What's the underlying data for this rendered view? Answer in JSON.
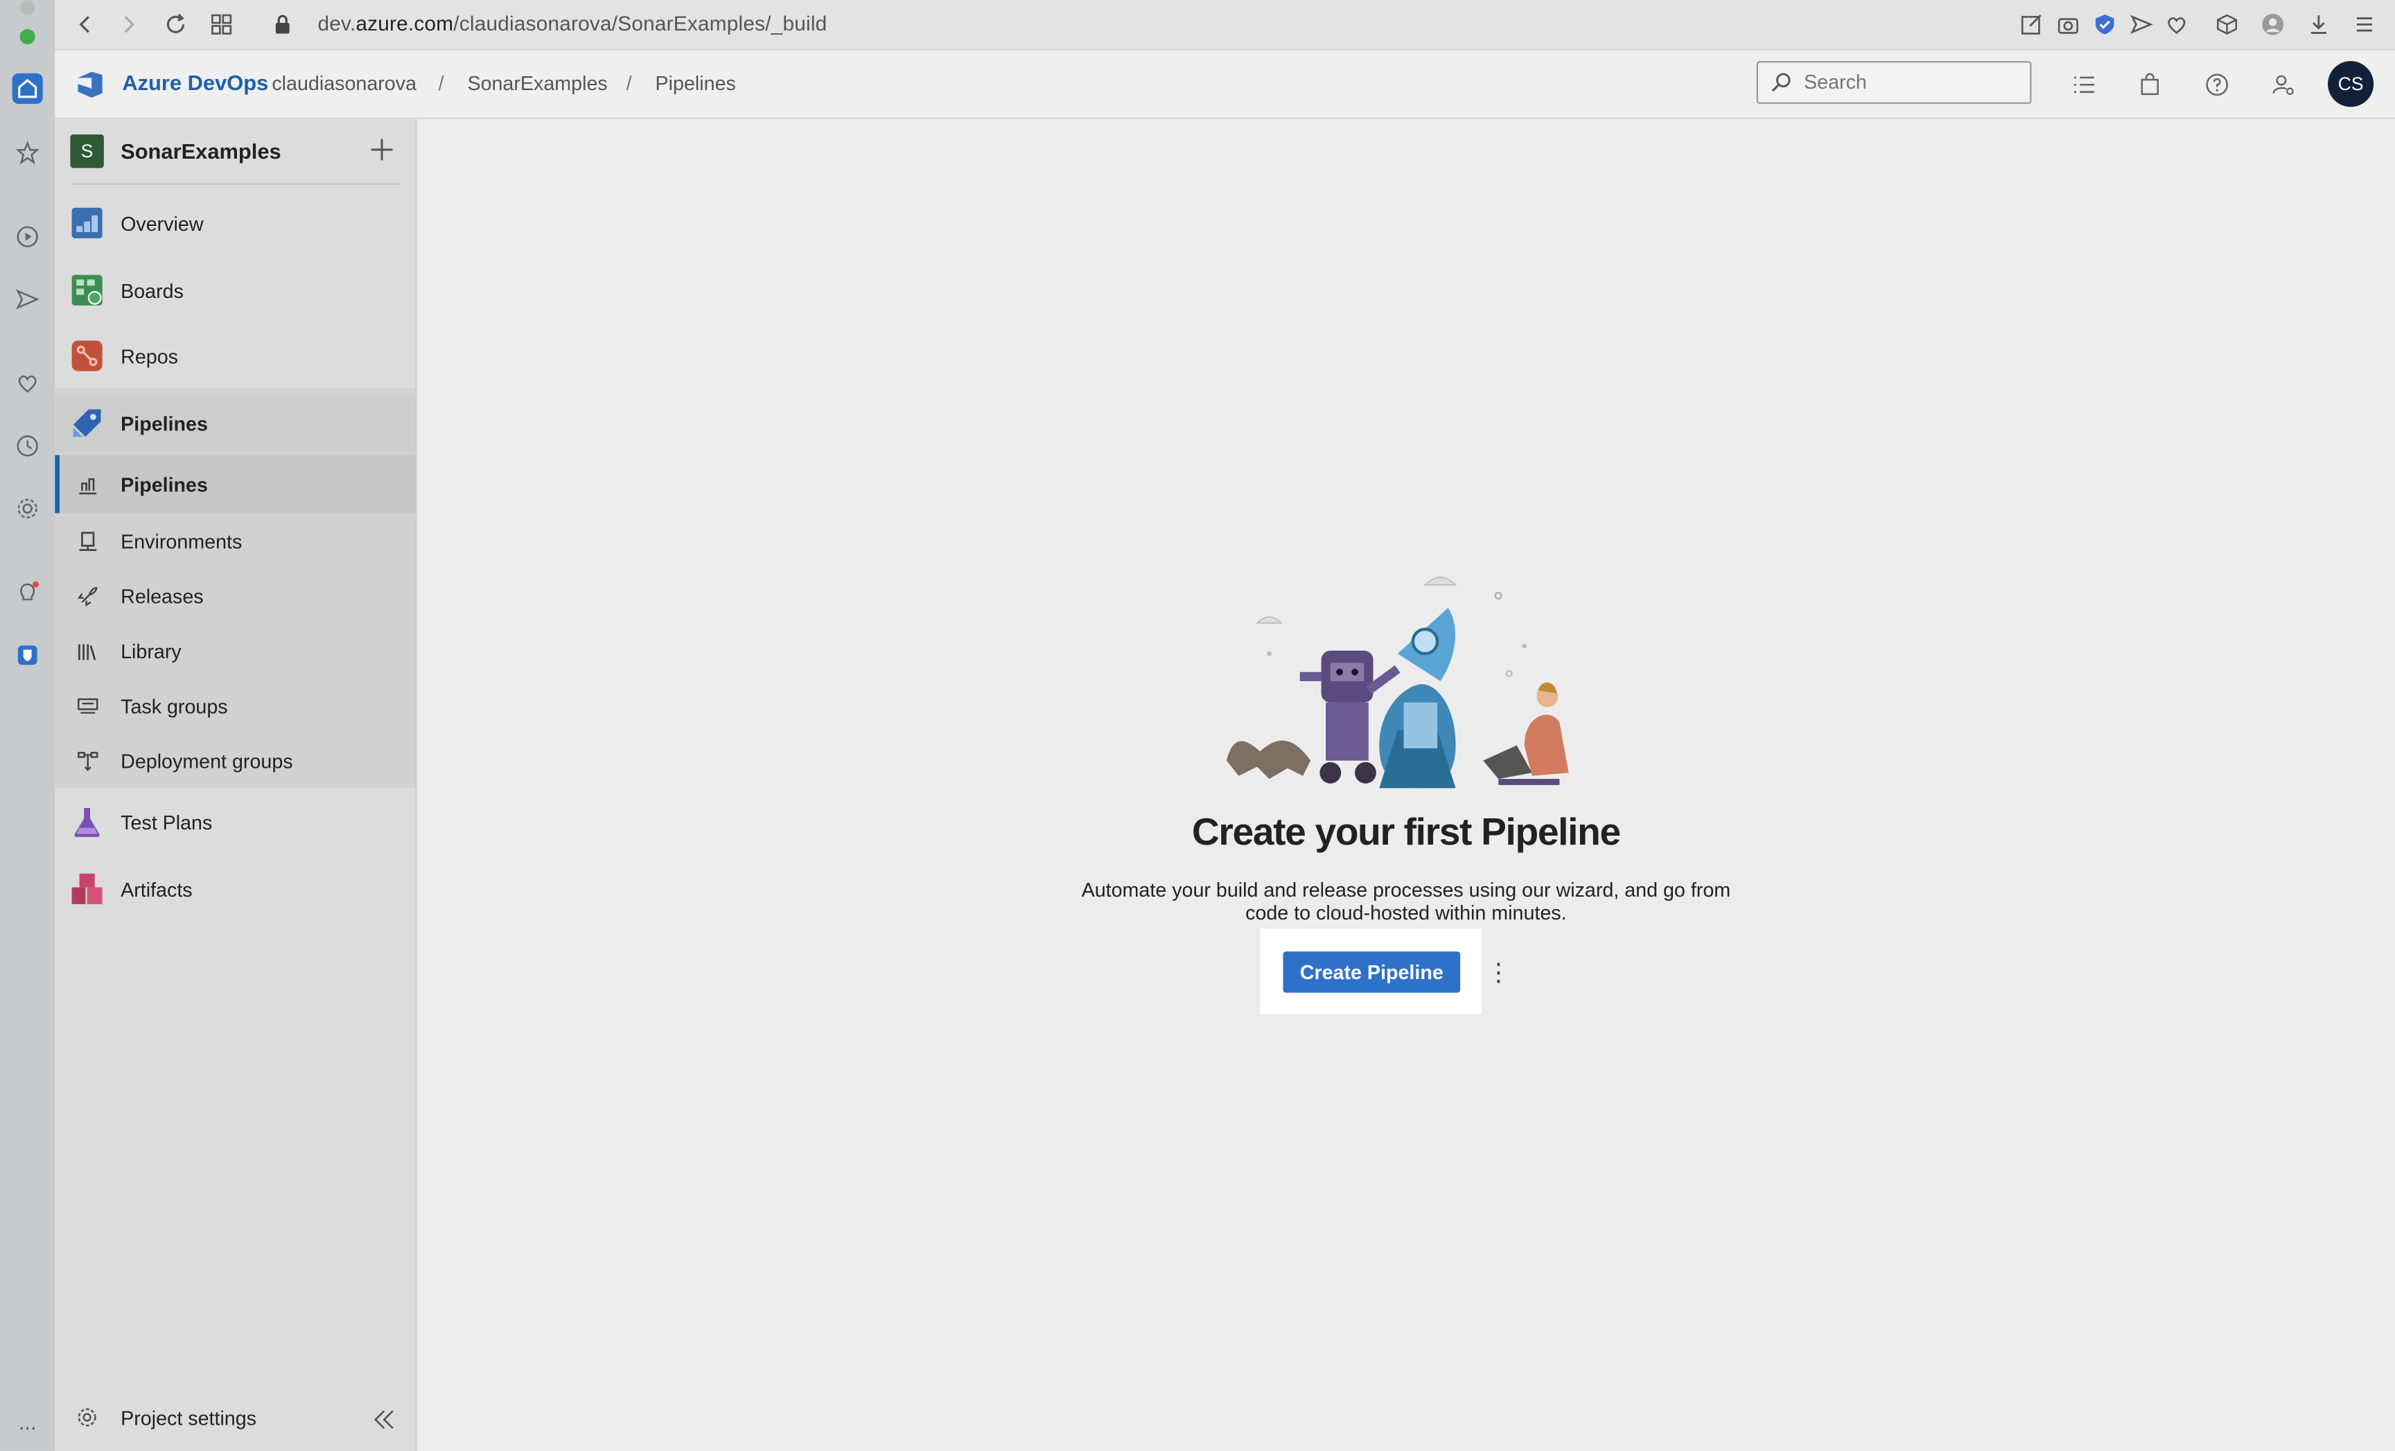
{
  "browser": {
    "url_prefix": "dev.",
    "url_domain": "azure.com",
    "url_path": "/claudiasonarova/SonarExamples/_build",
    "rail_icons": [
      "home-icon",
      "star-icon",
      "play-icon",
      "send-icon",
      "heart-icon",
      "clock-icon",
      "gear-icon",
      "lightbulb-icon",
      "vpn-shield-icon"
    ],
    "rail_more": "...",
    "toolbar_icons": [
      "back-arrow-icon",
      "forward-arrow-icon",
      "reload-icon",
      "tabs-grid-icon",
      "lock-icon",
      "edit-icon",
      "camera-icon",
      "shield-check-icon",
      "send-icon",
      "heart-icon",
      "cube-icon",
      "profile-icon",
      "download-icon",
      "menu-icon"
    ]
  },
  "header": {
    "brand": "Azure DevOps",
    "breadcrumb": [
      "claudiasonarova",
      "SonarExamples",
      "Pipelines"
    ],
    "separator": "/",
    "search_placeholder": "Search",
    "user_initials": "CS"
  },
  "sidebar": {
    "project_initial": "S",
    "project_name": "SonarExamples",
    "items": [
      {
        "label": "Overview"
      },
      {
        "label": "Boards"
      },
      {
        "label": "Repos"
      },
      {
        "label": "Pipelines"
      },
      {
        "label": "Pipelines"
      },
      {
        "label": "Environments"
      },
      {
        "label": "Releases"
      },
      {
        "label": "Library"
      },
      {
        "label": "Task groups"
      },
      {
        "label": "Deployment groups"
      },
      {
        "label": "Test Plans"
      },
      {
        "label": "Artifacts"
      }
    ],
    "settings_label": "Project settings"
  },
  "main": {
    "title": "Create your first Pipeline",
    "description": "Automate your build and release processes using our wizard, and go from code to cloud-hosted within minutes.",
    "create_button": "Create Pipeline",
    "more_glyph": "⋮"
  },
  "colors": {
    "accent": "#2d72c8",
    "brand_blue": "#1f5fa8",
    "avatar_bg": "#12213b",
    "project_badge": "#2e5a35"
  }
}
